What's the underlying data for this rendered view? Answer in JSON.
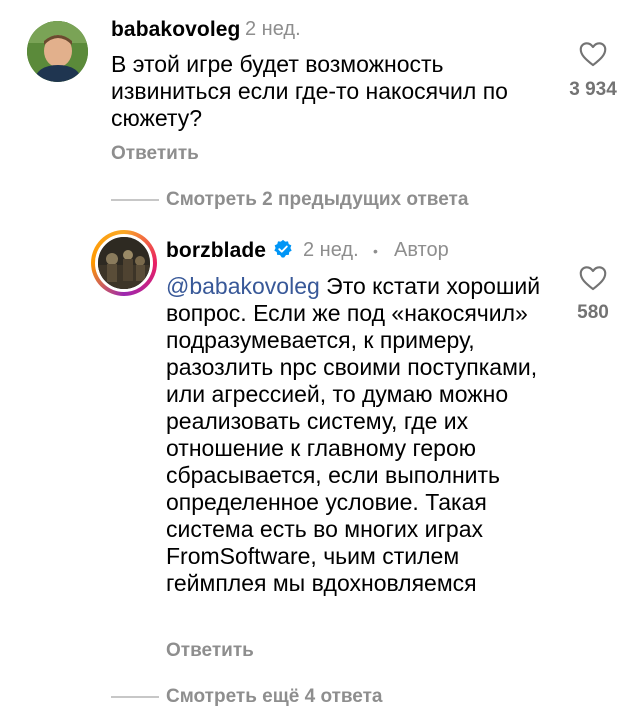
{
  "comment1": {
    "username": "babakovoleg",
    "time": "2 нед.",
    "text": "В этой игре будет возможность извиниться если где-то накосячил по сюжету?",
    "reply_label": "Ответить",
    "likes": "3 934"
  },
  "view_previous": "Смотреть 2 предыдущих ответа",
  "comment2": {
    "username": "borzblade",
    "time": "2 нед.",
    "author_badge": "Автор",
    "mention": "@babakovoleg",
    "text": " Это кстати хороший вопрос. Если же под «накосячил» подразумевается, к примеру, разозлить npc своими поступками, или агрессией, то думаю можно реализовать систему, где их отношение к главному герою сбрасывается, если выполнить определенное условие. Такая система есть во многих играх FromSoftware, чьим стилем геймплея мы вдохновляемся",
    "reply_label": "Ответить",
    "likes": "580"
  },
  "view_more": "Смотреть ещё 4 ответа",
  "colors": {
    "verified": "#0095f6",
    "muted": "#8e8e8e",
    "mention": "#385898"
  },
  "icons": {
    "like": "heart-outline-icon",
    "verified": "verified-badge-icon"
  }
}
